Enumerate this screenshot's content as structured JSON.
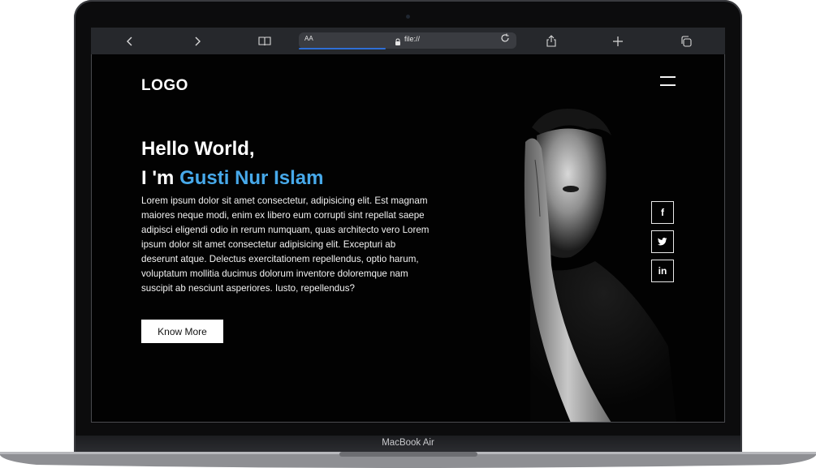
{
  "device": {
    "model_label": "MacBook Air"
  },
  "browser": {
    "address_text_size": "AA",
    "url": "file://",
    "icons": {
      "back": "chevron-left-icon",
      "forward": "chevron-right-icon",
      "bookmarks": "book-icon",
      "reload": "reload-icon",
      "share": "share-icon",
      "new_tab": "plus-icon",
      "tabs": "tabs-icon"
    },
    "progress": 0.4
  },
  "site": {
    "logo": "LOGO",
    "menu_icon": "hamburger-menu-icon",
    "hero": {
      "greeting": "Hello World,",
      "intro_prefix": "I 'm",
      "name": "Gusti Nur Islam",
      "description": "Lorem ipsum dolor sit amet consectetur, adipisicing elit. Est magnam maiores neque modi, enim ex libero eum corrupti sint repellat saepe adipisci eligendi odio in rerum numquam, quas architecto vero Lorem ipsum dolor sit amet consectetur adipisicing elit. Excepturi ab deserunt atque. Delectus exercitationem repellendus, optio harum, voluptatum mollitia ducimus dolorum inventore doloremque nam suscipit ab nesciunt asperiores. Iusto, repellendus?",
      "button_label": "Know More"
    },
    "social": [
      {
        "icon": "facebook-icon",
        "glyph": "f"
      },
      {
        "icon": "twitter-icon",
        "glyph": ""
      },
      {
        "icon": "linkedin-icon",
        "glyph": "in"
      }
    ]
  },
  "colors": {
    "accent": "#47a9ea",
    "page_background": "#020202",
    "toolbar": "#26282c",
    "progress": "#2f6fd6"
  }
}
